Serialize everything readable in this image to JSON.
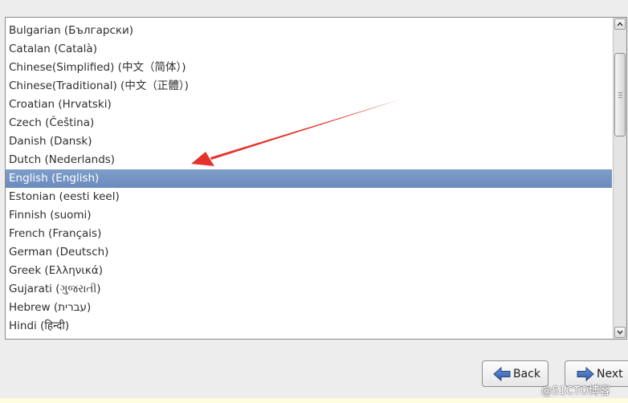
{
  "language_list": {
    "items": [
      {
        "label": "Bulgarian (Български)"
      },
      {
        "label": "Catalan (Català)"
      },
      {
        "label": "Chinese(Simplified) (中文（简体）)"
      },
      {
        "label": "Chinese(Traditional) (中文（正體）)"
      },
      {
        "label": "Croatian (Hrvatski)"
      },
      {
        "label": "Czech (Čeština)"
      },
      {
        "label": "Danish (Dansk)"
      },
      {
        "label": "Dutch (Nederlands)"
      },
      {
        "label": "English (English)"
      },
      {
        "label": "Estonian (eesti keel)"
      },
      {
        "label": "Finnish (suomi)"
      },
      {
        "label": "French (Français)"
      },
      {
        "label": "German (Deutsch)"
      },
      {
        "label": "Greek (Ελληνικά)"
      },
      {
        "label": "Gujarati (ગુજરાતી)"
      },
      {
        "label": "Hebrew (עברית)"
      },
      {
        "label": "Hindi (हिन्दी)"
      }
    ],
    "selected": "English (English)"
  },
  "buttons": {
    "back_label": "Back",
    "next_label": "Next"
  },
  "icons": {
    "back": "left-arrow-icon",
    "next": "right-arrow-icon",
    "scroll_up": "chevron-up-icon",
    "scroll_down": "chevron-down-icon"
  },
  "annotation": {
    "color": "#e5322d"
  },
  "watermark": {
    "text": "@51CTO博客"
  },
  "colors": {
    "selection": "#7393c4",
    "button_arrow": "#3a62a8"
  }
}
